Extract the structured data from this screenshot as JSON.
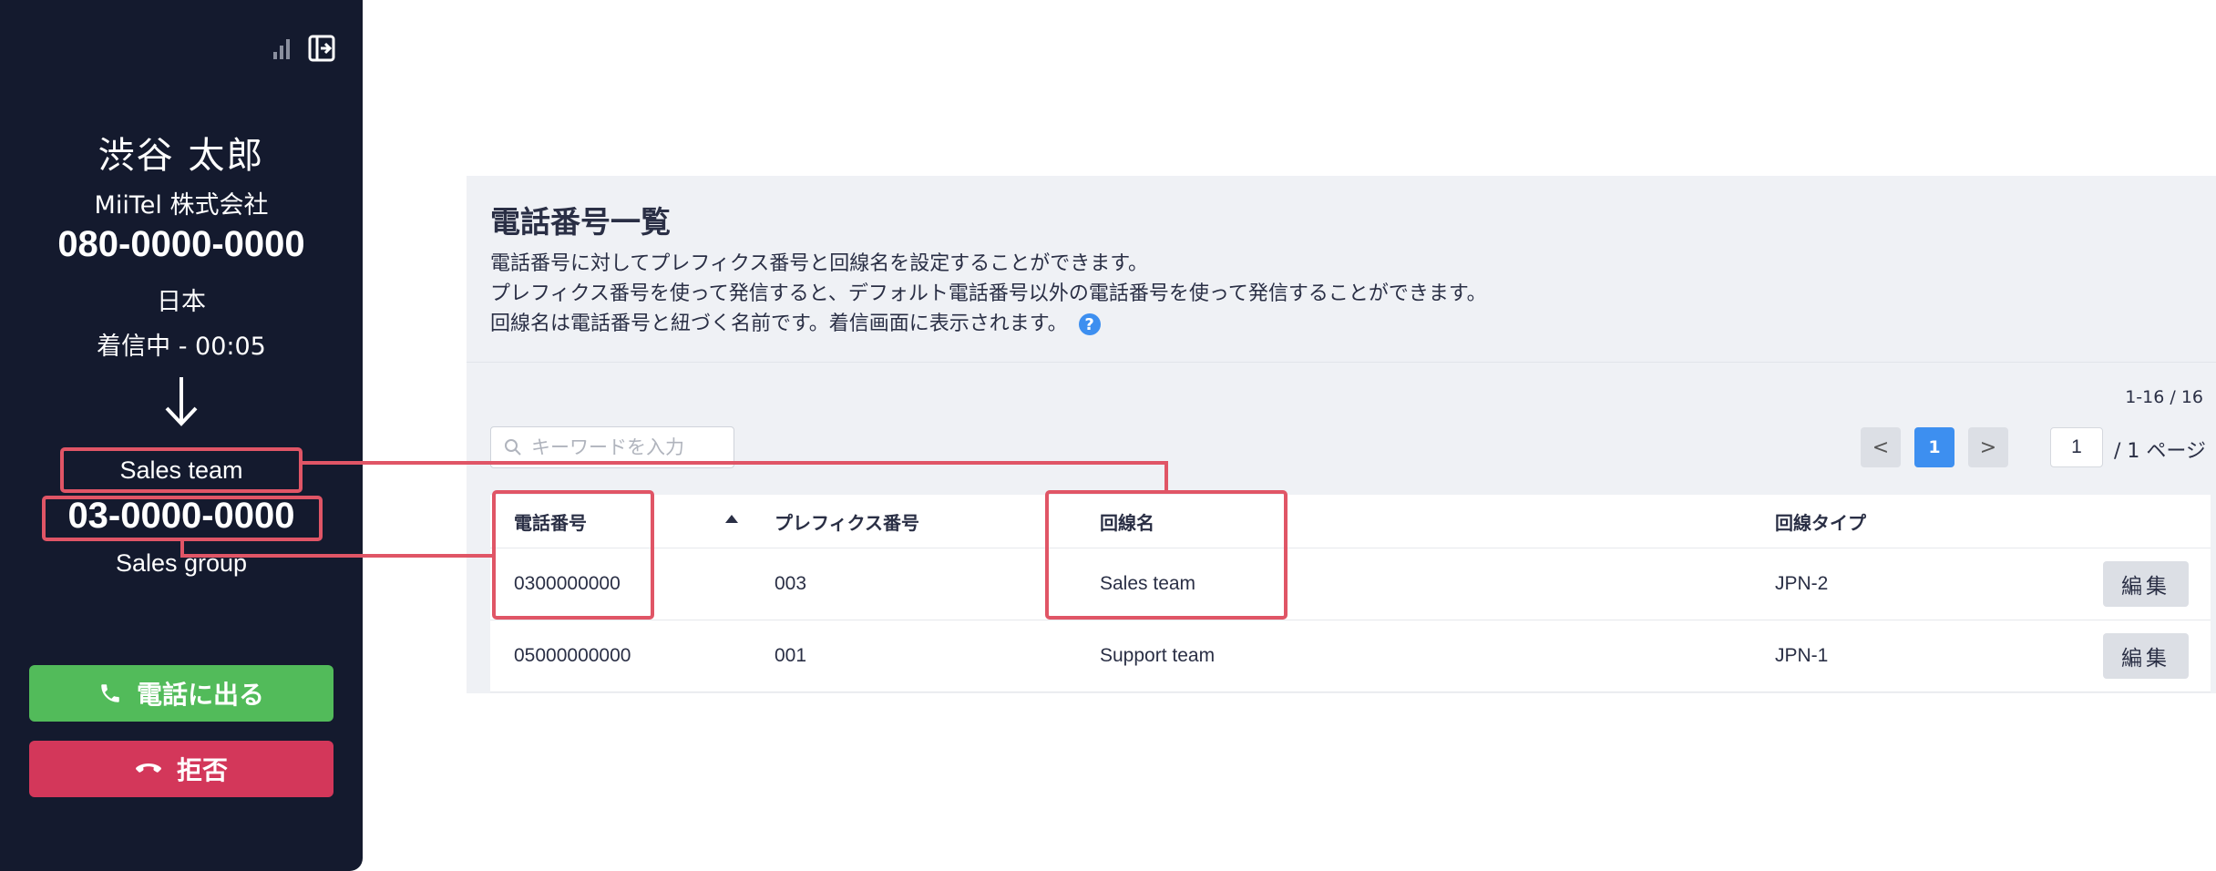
{
  "phone": {
    "caller_name": "渋谷 太郎",
    "company": "MiiTel 株式会社",
    "number": "080-0000-0000",
    "country": "日本",
    "status": "着信中 - 00:05",
    "line_name": "Sales team",
    "line_number": "03-0000-0000",
    "line_group": "Sales group",
    "answer_label": "電話に出る",
    "decline_label": "拒否"
  },
  "page": {
    "title": "電話番号一覧",
    "desc": [
      "電話番号に対してプレフィクス番号と回線名を設定することができます。",
      "プレフィクス番号を使って発信すると、デフォルト電話番号以外の電話番号を使って発信することができます。",
      "回線名は電話番号と紐づく名前です。着信画面に表示されます。"
    ],
    "count": "1-16 / 16",
    "search_placeholder": "キーワードを入力",
    "pagination": {
      "prev": "<",
      "current": "1",
      "next": ">",
      "input_value": "1",
      "total": "/ 1 ページ"
    }
  },
  "table": {
    "headers": [
      "電話番号",
      "プレフィクス番号",
      "回線名",
      "回線タイプ"
    ],
    "rows": [
      {
        "phone": "0300000000",
        "prefix": "003",
        "line_name": "Sales team",
        "line_type": "JPN-2",
        "action": "編集"
      },
      {
        "phone": "05000000000",
        "prefix": "001",
        "line_name": "Support team",
        "line_type": "JPN-1",
        "action": "編集"
      }
    ]
  },
  "icons": {
    "signal": "signal-icon",
    "exit": "exit-panel-icon",
    "arrow": "arrow-down-icon",
    "phone": "phone-icon",
    "hangup": "hangup-icon",
    "search": "search-icon",
    "help": "help-icon",
    "sort": "sort-up-icon"
  },
  "colors": {
    "panel_bg": "#141a2e",
    "answer": "#52bb5a",
    "decline": "#d3375a",
    "accent": "#3d8ff0",
    "annotation": "#e05566"
  }
}
